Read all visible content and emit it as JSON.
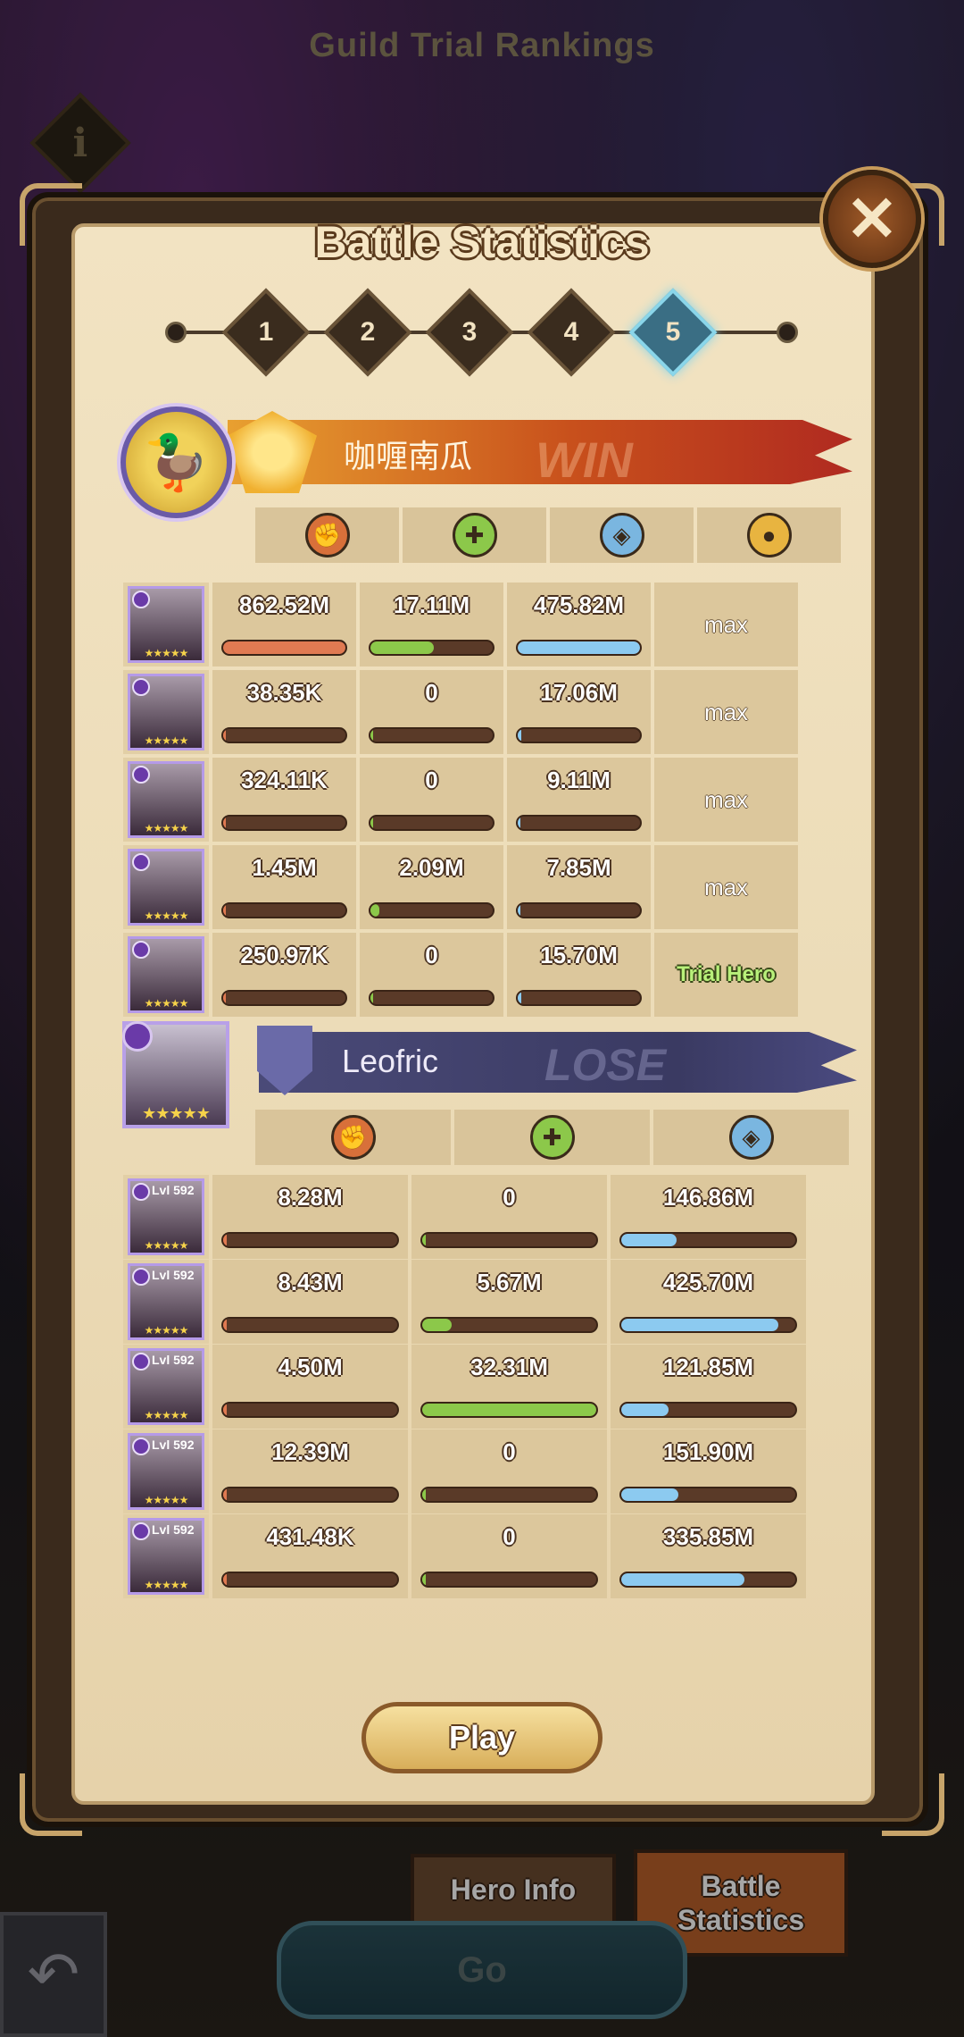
{
  "screen_title": "Guild Trial Rankings",
  "info_icon": "i",
  "dialog": {
    "title": "Battle Statistics",
    "close_icon": "✕",
    "rounds": [
      "1",
      "2",
      "3",
      "4",
      "5"
    ],
    "active_round": "5"
  },
  "attacker": {
    "name": "咖喱南瓜",
    "result": "WIN",
    "stat_columns": [
      "damage-icon",
      "healing-icon",
      "defense-icon",
      "energy-icon"
    ],
    "heroes": [
      {
        "damage": "862.52M",
        "damage_fill": 1.0,
        "healing": "17.11M",
        "healing_fill": 0.52,
        "defense": "475.82M",
        "defense_fill": 1.0,
        "energy": "max"
      },
      {
        "damage": "38.35K",
        "damage_fill": 0.0,
        "healing": "0",
        "healing_fill": 0.0,
        "defense": "17.06M",
        "defense_fill": 0.03,
        "energy": "max"
      },
      {
        "damage": "324.11K",
        "damage_fill": 0.0,
        "healing": "0",
        "healing_fill": 0.0,
        "defense": "9.11M",
        "defense_fill": 0.02,
        "energy": "max"
      },
      {
        "damage": "1.45M",
        "damage_fill": 0.01,
        "healing": "2.09M",
        "healing_fill": 0.07,
        "defense": "7.85M",
        "defense_fill": 0.02,
        "energy": "max"
      },
      {
        "damage": "250.97K",
        "damage_fill": 0.0,
        "healing": "0",
        "healing_fill": 0.0,
        "defense": "15.70M",
        "defense_fill": 0.03,
        "energy": "Trial Hero"
      }
    ]
  },
  "defender": {
    "name": "Leofric",
    "result": "LOSE",
    "stat_columns": [
      "damage-icon",
      "healing-icon",
      "defense-icon"
    ],
    "heroes": [
      {
        "level": "Lvl 592",
        "damage": "8.28M",
        "damage_fill": 0.01,
        "healing": "0",
        "healing_fill": 0.0,
        "defense": "146.86M",
        "defense_fill": 0.32
      },
      {
        "level": "Lvl 592",
        "damage": "8.43M",
        "damage_fill": 0.01,
        "healing": "5.67M",
        "healing_fill": 0.17,
        "defense": "425.70M",
        "defense_fill": 0.9
      },
      {
        "level": "Lvl 592",
        "damage": "4.50M",
        "damage_fill": 0.01,
        "healing": "32.31M",
        "healing_fill": 1.0,
        "defense": "121.85M",
        "defense_fill": 0.27
      },
      {
        "level": "Lvl 592",
        "damage": "12.39M",
        "damage_fill": 0.01,
        "healing": "0",
        "healing_fill": 0.0,
        "defense": "151.90M",
        "defense_fill": 0.33
      },
      {
        "level": "Lvl 592",
        "damage": "431.48K",
        "damage_fill": 0.0,
        "healing": "0",
        "healing_fill": 0.0,
        "defense": "335.85M",
        "defense_fill": 0.71
      }
    ]
  },
  "play_label": "Play",
  "tabs": {
    "hero_info": "Hero Info",
    "battle_statistics": "Battle Statistics"
  },
  "go_label": "Go",
  "back_icon": "↶",
  "colors": {
    "damage": "#e07a52",
    "healing": "#8cc84a",
    "defense": "#8ccaf0",
    "active_round": "#8ad6ea"
  }
}
